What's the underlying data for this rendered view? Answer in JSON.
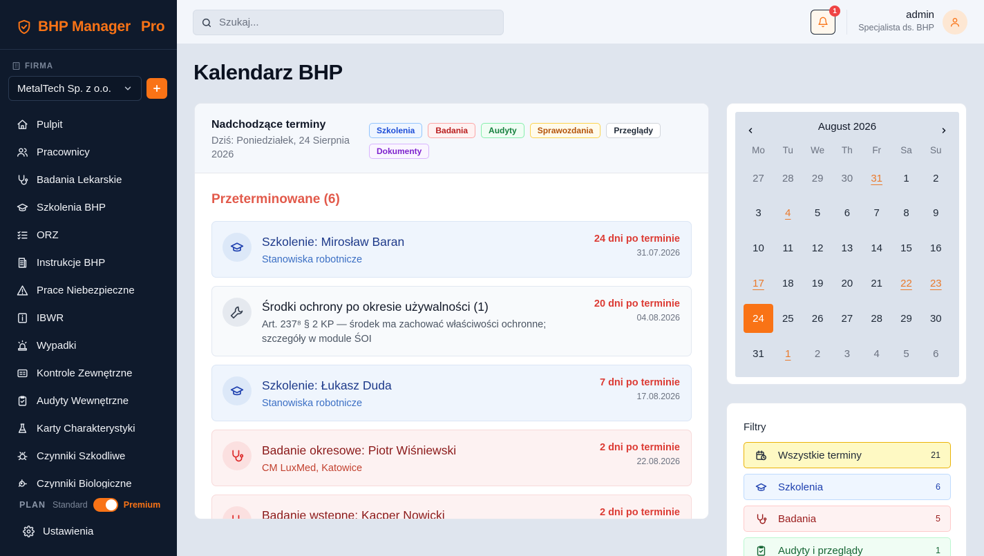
{
  "app": {
    "name": "BHP Manager",
    "badge": "Pro"
  },
  "sidebar": {
    "firma_label": "FIRMA",
    "company": "MetalTech Sp. z o.o.",
    "items": [
      {
        "label": "Pulpit",
        "icon": "home-icon"
      },
      {
        "label": "Pracownicy",
        "icon": "users-icon"
      },
      {
        "label": "Badania Lekarskie",
        "icon": "stethoscope-icon"
      },
      {
        "label": "Szkolenia BHP",
        "icon": "graduation-cap-icon"
      },
      {
        "label": "ORZ",
        "icon": "list-check-icon"
      },
      {
        "label": "Instrukcje BHP",
        "icon": "document-icon"
      },
      {
        "label": "Prace Niebezpieczne",
        "icon": "warning-icon"
      },
      {
        "label": "IBWR",
        "icon": "info-icon"
      },
      {
        "label": "Wypadki",
        "icon": "siren-icon"
      },
      {
        "label": "Kontrole Zewnętrzne",
        "icon": "id-card-icon"
      },
      {
        "label": "Audyty Wewnętrzne",
        "icon": "clipboard-check-icon"
      },
      {
        "label": "Karty Charakterystyki",
        "icon": "flask-icon"
      },
      {
        "label": "Czynniki Szkodliwe",
        "icon": "bug-icon"
      },
      {
        "label": "Czynniki Biologiczne",
        "icon": "microbe-icon"
      }
    ],
    "plan": {
      "label": "PLAN",
      "standard": "Standard",
      "premium": "Premium"
    },
    "settings": "Ustawienia"
  },
  "topbar": {
    "search_placeholder": "Szukaj...",
    "notifications_count": "1",
    "user_name": "admin",
    "user_role": "Specjalista ds. BHP"
  },
  "page_title": "Kalendarz BHP",
  "upcoming": {
    "title": "Nadchodzące terminy",
    "today": "Dziś: Poniedziałek, 24 Sierpnia 2026",
    "tags": [
      {
        "label": "Szkolenia",
        "color": "#1d4ed8",
        "bg": "#eff6ff",
        "border": "#93c5fd"
      },
      {
        "label": "Badania",
        "color": "#b91c1c",
        "bg": "#fef2f2",
        "border": "#fca5a5"
      },
      {
        "label": "Audyty",
        "color": "#15803d",
        "bg": "#f0fdf4",
        "border": "#86efac"
      },
      {
        "label": "Sprawozdania",
        "color": "#b45309",
        "bg": "#fffbeb",
        "border": "#fcd34d"
      },
      {
        "label": "Przeglądy",
        "color": "#1f2937",
        "bg": "#ffffff",
        "border": "#d1d5db"
      },
      {
        "label": "Dokumenty",
        "color": "#7e22ce",
        "bg": "#faf5ff",
        "border": "#d8b4fe"
      }
    ],
    "overdue_title": "Przeterminowane (6)",
    "items": [
      {
        "kind": "szkolenie",
        "title": "Szkolenie: Mirosław Baran",
        "subtitle": "Stanowiska robotnicze",
        "due": "24 dni po terminie",
        "date": "31.07.2026"
      },
      {
        "kind": "srodki",
        "title": "Środki ochrony po okresie używalności (1)",
        "subtitle": "Art. 237⁸ § 2 KP — środek ma zachować właściwości ochronne; szczegóły w module ŚOI",
        "due": "20 dni po terminie",
        "date": "04.08.2026"
      },
      {
        "kind": "szkolenie",
        "title": "Szkolenie: Łukasz Duda",
        "subtitle": "Stanowiska robotnicze",
        "due": "7 dni po terminie",
        "date": "17.08.2026"
      },
      {
        "kind": "badanie",
        "title": "Badanie okresowe: Piotr Wiśniewski",
        "subtitle": "CM LuxMed, Katowice",
        "due": "2 dni po terminie",
        "date": "22.08.2026"
      },
      {
        "kind": "badanie",
        "title": "Badanie wstępne: Kacper Nowicki",
        "subtitle": "",
        "due": "2 dni po terminie",
        "date": ""
      }
    ]
  },
  "calendar": {
    "month": "August 2026",
    "weekdays": [
      "Mo",
      "Tu",
      "We",
      "Th",
      "Fr",
      "Sa",
      "Su"
    ],
    "weeks": [
      [
        {
          "d": "27",
          "m": 1
        },
        {
          "d": "28",
          "m": 1
        },
        {
          "d": "29",
          "m": 1
        },
        {
          "d": "30",
          "m": 1
        },
        {
          "d": "31",
          "m": 1,
          "h": 1
        },
        {
          "d": "1"
        },
        {
          "d": "2"
        }
      ],
      [
        {
          "d": "3"
        },
        {
          "d": "4",
          "h": 1
        },
        {
          "d": "5"
        },
        {
          "d": "6"
        },
        {
          "d": "7"
        },
        {
          "d": "8"
        },
        {
          "d": "9"
        }
      ],
      [
        {
          "d": "10"
        },
        {
          "d": "11"
        },
        {
          "d": "12"
        },
        {
          "d": "13"
        },
        {
          "d": "14"
        },
        {
          "d": "15"
        },
        {
          "d": "16"
        }
      ],
      [
        {
          "d": "17",
          "h": 1
        },
        {
          "d": "18"
        },
        {
          "d": "19"
        },
        {
          "d": "20"
        },
        {
          "d": "21"
        },
        {
          "d": "22",
          "h": 1
        },
        {
          "d": "23",
          "h": 1
        }
      ],
      [
        {
          "d": "24",
          "t": 1
        },
        {
          "d": "25"
        },
        {
          "d": "26"
        },
        {
          "d": "27"
        },
        {
          "d": "28"
        },
        {
          "d": "29"
        },
        {
          "d": "30"
        }
      ],
      [
        {
          "d": "31"
        },
        {
          "d": "1",
          "m": 1,
          "h": 1
        },
        {
          "d": "2",
          "m": 1
        },
        {
          "d": "3",
          "m": 1
        },
        {
          "d": "4",
          "m": 1
        },
        {
          "d": "5",
          "m": 1
        },
        {
          "d": "6",
          "m": 1
        }
      ]
    ]
  },
  "filters": {
    "title": "Filtry",
    "items": [
      {
        "label": "Wszystkie terminy",
        "count": "21",
        "icon": "calendar-clock-icon",
        "color": "#1f2937",
        "bg": "#fef9c3",
        "border": "#eab308"
      },
      {
        "label": "Szkolenia",
        "count": "6",
        "icon": "graduation-cap-icon",
        "color": "#1e40af",
        "bg": "#eff6ff",
        "border": "#bfdbfe"
      },
      {
        "label": "Badania",
        "count": "5",
        "icon": "stethoscope-icon",
        "color": "#991b1b",
        "bg": "#fef2f2",
        "border": "#fecaca"
      },
      {
        "label": "Audyty i przeglądy",
        "count": "1",
        "icon": "clipboard-check-icon",
        "color": "#166534",
        "bg": "#f0fdf4",
        "border": "#bbf7d0"
      }
    ]
  }
}
